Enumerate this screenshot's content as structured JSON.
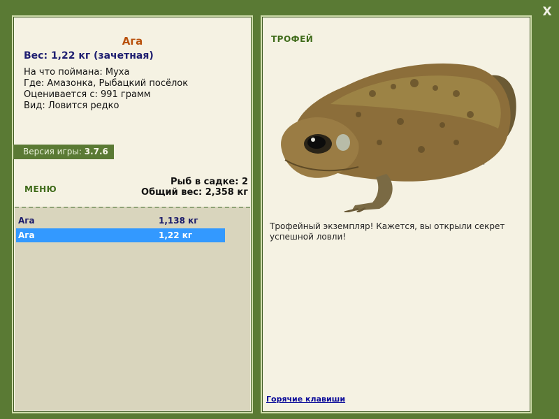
{
  "close_label": "X",
  "fish": {
    "name": "Ага",
    "weight": "Вес: 1,22 кг (зачетная)",
    "info": [
      "На что поймана: Муха",
      "Где: Амазонка, Рыбацкий посёлок",
      "Оценивается с: 991 грамм",
      "Вид: Ловится редко"
    ]
  },
  "version": {
    "label": "Версия игры:",
    "value": "3.7.6"
  },
  "menu_label": "МЕНЮ",
  "stats": {
    "count": "Рыб в садке: 2",
    "total": "Общий вес: 2,358 кг"
  },
  "catch_list": [
    {
      "name": "Ага",
      "weight": "1,138 кг"
    },
    {
      "name": "Ага",
      "weight": "1,22 кг"
    }
  ],
  "trophy_label": "ТРОФЕЙ",
  "description": "Трофейный экземпляр! Кажется, вы открыли секрет успешной ловли!",
  "hotkeys_label": "Горячие клавиши",
  "colors": {
    "frame": "#5a7a34",
    "selected_row": "#3399ff",
    "fish_name": "#b9520e"
  }
}
